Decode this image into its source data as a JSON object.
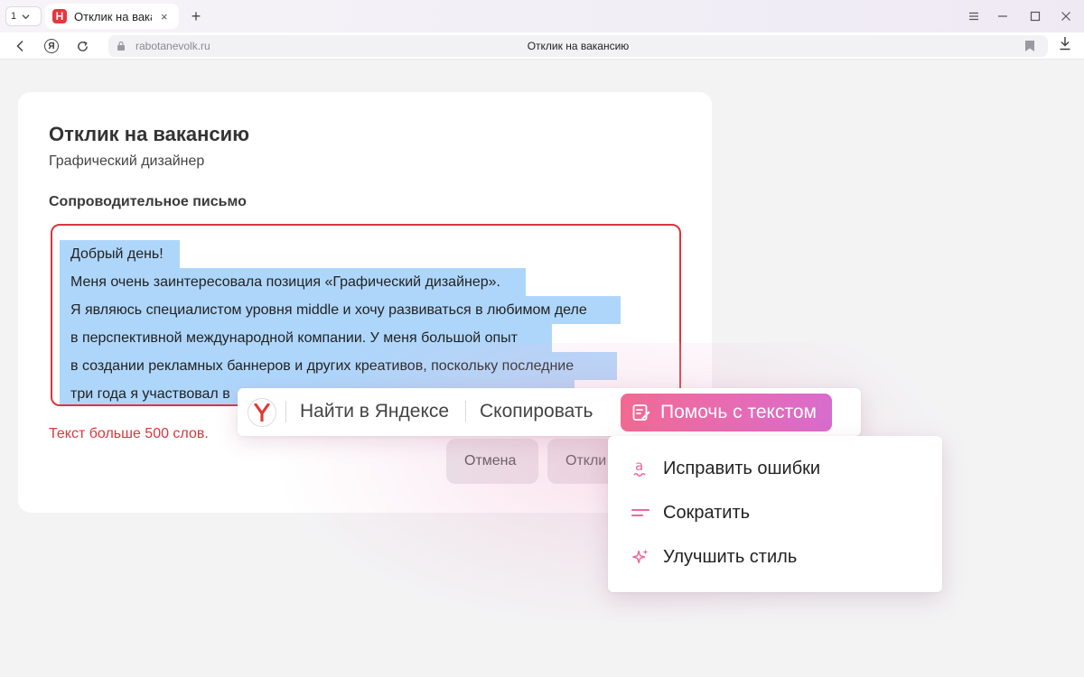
{
  "browser": {
    "tab_count": "1",
    "tab": {
      "title": "Отклик на вакансию",
      "close": "×",
      "favicon_letter": "Н"
    },
    "new_tab_symbol": "+",
    "address": {
      "domain": "rabotanevolk.ru",
      "page_title": "Отклик на вакансию"
    },
    "yandex_button_letter": "Я"
  },
  "page": {
    "title": "Отклик на вакансию",
    "subtitle": "Графический дизайнер",
    "field_label": "Сопроводительное письмо",
    "letter_lines": [
      "Добрый день!",
      "Меня очень заинтересовала позиция «Графический дизайнер».",
      "Я являюсь специалистом уровня middle и хочу развиваться в любимом деле",
      "в перспективной международной компании. У меня большой опыт",
      "в создании рекламных баннеров и других креативов, поскольку последние",
      "три года я участвовал в"
    ],
    "error": "Текст больше 500 слов.",
    "cancel_button": "Отмена",
    "apply_button": "Откли"
  },
  "context_toolbar": {
    "search": "Найти в Яндексе",
    "copy": "Скопировать",
    "help": "Помочь с текстом"
  },
  "menu": {
    "items": [
      {
        "label": "Исправить ошибки",
        "icon": "spell-check-icon"
      },
      {
        "label": "Сократить",
        "icon": "shorten-icon"
      },
      {
        "label": "Улучшить стиль",
        "icon": "sparkles-icon"
      }
    ]
  },
  "colors": {
    "error": "#d9363e",
    "selection": "#aed6fb",
    "accent_from": "#f26a93",
    "accent_to": "#d86ccd",
    "menu_icon": "#e8689c"
  }
}
